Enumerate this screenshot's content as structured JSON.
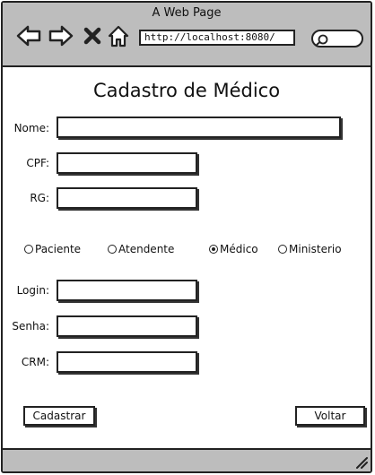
{
  "window": {
    "title": "A Web Page"
  },
  "browser": {
    "address": "http://localhost:8080/",
    "icons": [
      "back-arrow-icon",
      "forward-arrow-icon",
      "close-x-icon",
      "home-icon",
      "search-icon",
      "resize-grip-icon"
    ]
  },
  "form": {
    "title": "Cadastro de Médico",
    "fields": {
      "nome": {
        "label": "Nome:",
        "value": ""
      },
      "cpf": {
        "label": "CPF:",
        "value": ""
      },
      "rg": {
        "label": "RG:",
        "value": ""
      },
      "login": {
        "label": "Login:",
        "value": ""
      },
      "senha": {
        "label": "Senha:",
        "value": ""
      },
      "crm": {
        "label": "CRM:",
        "value": ""
      }
    },
    "roles": {
      "options": [
        "Paciente",
        "Atendente",
        "Médico",
        "Ministerio"
      ],
      "selected": "Médico"
    },
    "buttons": {
      "submit": "Cadastrar",
      "back": "Voltar"
    }
  },
  "colors": {
    "chrome": "#bdbdbd",
    "stroke": "#222222",
    "background": "#ffffff"
  }
}
